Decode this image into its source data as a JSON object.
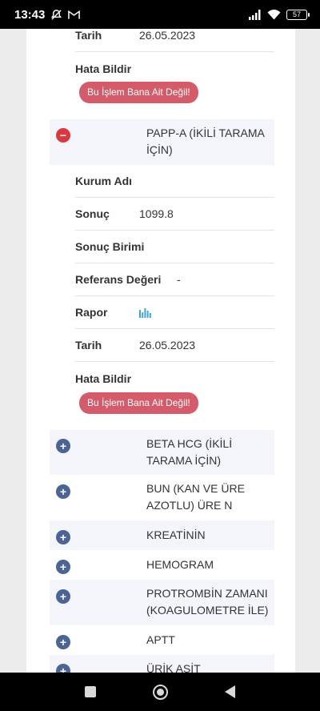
{
  "status_bar": {
    "time": "13:43",
    "battery": "57"
  },
  "top_section": {
    "date_label": "Tarih",
    "date_value": "26.05.2023",
    "report_label": "Hata Bildir",
    "report_button": "Bu İşlem Bana Ait Değil!"
  },
  "expanded_group": {
    "title": "PAPP-A (İKİLİ TARAMA İÇİN)",
    "fields": {
      "institution_label": "Kurum Adı",
      "institution_value": "",
      "result_label": "Sonuç",
      "result_value": "1099.8",
      "unit_label": "Sonuç Birimi",
      "unit_value": "",
      "reference_label": "Referans Değeri",
      "reference_value": "-",
      "report_file_label": "Rapor",
      "date_label": "Tarih",
      "date_value": "26.05.2023"
    },
    "report_label": "Hata Bildir",
    "report_button": "Bu İşlem Bana Ait Değil!"
  },
  "collapsed_groups": [
    {
      "title": "BETA HCG (İKİLİ TARAMA İÇİN)"
    },
    {
      "title": "BUN (KAN VE ÜRE AZOTLU) ÜRE N"
    },
    {
      "title": "KREATİNİN"
    },
    {
      "title": "HEMOGRAM"
    },
    {
      "title": "PROTROMBİN ZAMANI (KOAGULOMETRE İLE)"
    },
    {
      "title": "APTT"
    },
    {
      "title": "ÜRİK ASİT"
    }
  ],
  "colors": {
    "report_button": "#d45c6a",
    "collapse_icon": "#d9383f",
    "expand_icon": "#4c6494",
    "chart_icon": "#3ea6d8"
  }
}
